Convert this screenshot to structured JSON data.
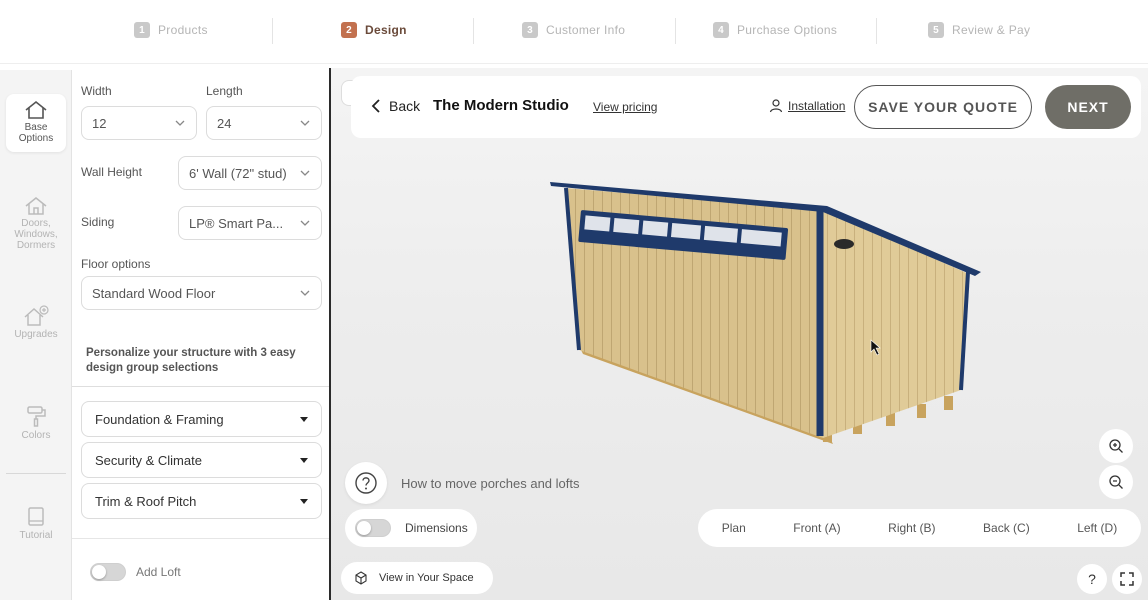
{
  "steps": [
    {
      "num": "1",
      "label": "Products"
    },
    {
      "num": "2",
      "label": "Design"
    },
    {
      "num": "3",
      "label": "Customer Info"
    },
    {
      "num": "4",
      "label": "Purchase Options"
    },
    {
      "num": "5",
      "label": "Review & Pay"
    }
  ],
  "active_step": "Design",
  "rail": {
    "base": "Base Options",
    "doors": "Doors, Windows, Dormers",
    "upgrades": "Upgrades",
    "colors": "Colors",
    "tutorial": "Tutorial"
  },
  "options": {
    "width_label": "Width",
    "width_value": "12",
    "length_label": "Length",
    "length_value": "24",
    "wall_height_label": "Wall Height",
    "wall_height_value": "6' Wall (72\" stud)",
    "siding_label": "Siding",
    "siding_value": "LP® Smart Pa...",
    "floor_label": "Floor options",
    "floor_value": "Standard Wood Floor",
    "personalize_text": "Personalize your structure with 3 easy design group selections",
    "groups": [
      "Foundation & Framing",
      "Security & Climate",
      "Trim & Roof Pitch"
    ],
    "add_loft_label": "Add Loft"
  },
  "header": {
    "back_label": "Back",
    "title": "The Modern Studio",
    "view_pricing": "View pricing",
    "installation": "Installation",
    "save_quote": "SAVE YOUR QUOTE",
    "next": "NEXT"
  },
  "viewport": {
    "help_text": "How to move porches and lofts",
    "dimensions_label": "Dimensions",
    "views": [
      "Plan",
      "Front (A)",
      "Right (B)",
      "Back (C)",
      "Left (D)"
    ],
    "view_in_space": "View in Your Space",
    "help_icon_text": "?"
  },
  "colors": {
    "accent": "#c2714f",
    "next_button": "#6f6e67",
    "trim": "#1f3a6b",
    "siding": "#d8c08b"
  }
}
